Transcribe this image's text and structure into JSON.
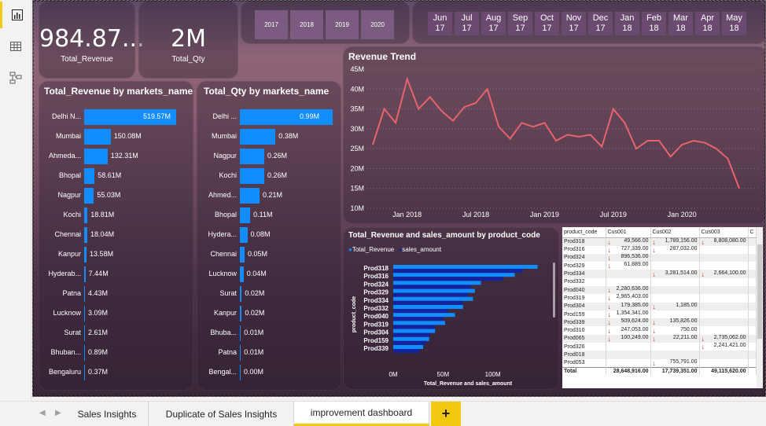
{
  "rail": {
    "icons": [
      "report-view-icon",
      "data-view-icon",
      "model-view-icon"
    ]
  },
  "kpi": {
    "revenue": {
      "value": "984.87...",
      "label": "Total_Revenue"
    },
    "qty": {
      "value": "2M",
      "label": "Total_Qty"
    }
  },
  "year_slicer": [
    "2017",
    "2018",
    "2019",
    "2020"
  ],
  "month_slicer": [
    {
      "m": "Jun",
      "y": "17"
    },
    {
      "m": "Jul",
      "y": "17"
    },
    {
      "m": "Aug",
      "y": "17"
    },
    {
      "m": "Sep",
      "y": "17"
    },
    {
      "m": "Oct",
      "y": "17"
    },
    {
      "m": "Nov",
      "y": "17"
    },
    {
      "m": "Dec",
      "y": "17"
    },
    {
      "m": "Jan",
      "y": "18"
    },
    {
      "m": "Feb",
      "y": "18"
    },
    {
      "m": "Mar",
      "y": "18"
    },
    {
      "m": "Apr",
      "y": "18"
    },
    {
      "m": "May",
      "y": "18"
    }
  ],
  "revenue_by_market": {
    "title": "Total_Revenue by markets_name",
    "bar_color": "#118dff",
    "items": [
      {
        "name": "Delhi N...",
        "value": 519.57,
        "label": "519.57M"
      },
      {
        "name": "Mumbai",
        "value": 150.08,
        "label": "150.08M"
      },
      {
        "name": "Ahmeda...",
        "value": 132.31,
        "label": "132.31M"
      },
      {
        "name": "Bhopal",
        "value": 58.61,
        "label": "58.61M"
      },
      {
        "name": "Nagpur",
        "value": 55.03,
        "label": "55.03M"
      },
      {
        "name": "Kochi",
        "value": 18.81,
        "label": "18.81M"
      },
      {
        "name": "Chennai",
        "value": 18.04,
        "label": "18.04M"
      },
      {
        "name": "Kanpur",
        "value": 13.58,
        "label": "13.58M"
      },
      {
        "name": "Hyderab...",
        "value": 7.44,
        "label": "7.44M"
      },
      {
        "name": "Patna",
        "value": 4.43,
        "label": "4.43M"
      },
      {
        "name": "Lucknow",
        "value": 3.09,
        "label": "3.09M"
      },
      {
        "name": "Surat",
        "value": 2.61,
        "label": "2.61M"
      },
      {
        "name": "Bhuban...",
        "value": 0.89,
        "label": "0.89M"
      },
      {
        "name": "Bengaluru",
        "value": 0.37,
        "label": "0.37M"
      }
    ]
  },
  "qty_by_market": {
    "title": "Total_Qty by markets_name",
    "bar_color": "#118dff",
    "items": [
      {
        "name": "Delhi ...",
        "value": 0.99,
        "label": "0.99M"
      },
      {
        "name": "Mumbai",
        "value": 0.38,
        "label": "0.38M"
      },
      {
        "name": "Nagpur",
        "value": 0.26,
        "label": "0.26M"
      },
      {
        "name": "Kochi",
        "value": 0.26,
        "label": "0.26M"
      },
      {
        "name": "Ahmed...",
        "value": 0.21,
        "label": "0.21M"
      },
      {
        "name": "Bhopal",
        "value": 0.11,
        "label": "0.11M"
      },
      {
        "name": "Hydera...",
        "value": 0.08,
        "label": "0.08M"
      },
      {
        "name": "Chennai",
        "value": 0.05,
        "label": "0.05M"
      },
      {
        "name": "Lucknow",
        "value": 0.04,
        "label": "0.04M"
      },
      {
        "name": "Surat",
        "value": 0.02,
        "label": "0.02M"
      },
      {
        "name": "Kanpur",
        "value": 0.02,
        "label": "0.02M"
      },
      {
        "name": "Bhuba...",
        "value": 0.01,
        "label": "0.01M"
      },
      {
        "name": "Patna",
        "value": 0.01,
        "label": "0.01M"
      },
      {
        "name": "Bengal...",
        "value": 0.0,
        "label": "0.00M"
      }
    ]
  },
  "revenue_trend": {
    "title": "Revenue Trend",
    "line_color": "#e8636f",
    "y_ticks": [
      "45M",
      "40M",
      "35M",
      "30M",
      "25M",
      "20M",
      "15M",
      "10M"
    ],
    "x_ticks": [
      "Jan 2018",
      "Jul 2018",
      "Jan 2019",
      "Jul 2019",
      "Jan 2020"
    ]
  },
  "product_chart": {
    "title": "Total_Revenue and sales_amount by product_code",
    "legend": [
      {
        "name": "Total_Revenue",
        "color": "#118dff"
      },
      {
        "name": "sales_amount",
        "color": "#12239e"
      }
    ],
    "y_axis_title": "product_code",
    "x_axis_title": "Total_Revenue and sales_amount",
    "x_ticks": [
      "0M",
      "50M",
      "100M"
    ]
  },
  "chart_data": [
    {
      "type": "bar",
      "title": "Total_Revenue by markets_name",
      "categories": [
        "Delhi N...",
        "Mumbai",
        "Ahmeda...",
        "Bhopal",
        "Nagpur",
        "Kochi",
        "Chennai",
        "Kanpur",
        "Hyderab...",
        "Patna",
        "Lucknow",
        "Surat",
        "Bhuban...",
        "Bengaluru"
      ],
      "values": [
        519.57,
        150.08,
        132.31,
        58.61,
        55.03,
        18.81,
        18.04,
        13.58,
        7.44,
        4.43,
        3.09,
        2.61,
        0.89,
        0.37
      ]
    },
    {
      "type": "bar",
      "title": "Total_Qty by markets_name",
      "categories": [
        "Delhi ...",
        "Mumbai",
        "Nagpur",
        "Kochi",
        "Ahmed...",
        "Bhopal",
        "Hydera...",
        "Chennai",
        "Lucknow",
        "Surat",
        "Kanpur",
        "Bhuba...",
        "Patna",
        "Bengal..."
      ],
      "values": [
        0.99,
        0.38,
        0.26,
        0.26,
        0.21,
        0.11,
        0.08,
        0.05,
        0.04,
        0.02,
        0.02,
        0.01,
        0.01,
        0.0
      ]
    },
    {
      "type": "line",
      "title": "Revenue Trend",
      "x": [
        "2017-10",
        "2017-11",
        "2017-12",
        "2018-01",
        "2018-02",
        "2018-03",
        "2018-04",
        "2018-05",
        "2018-06",
        "2018-07",
        "2018-08",
        "2018-09",
        "2018-10",
        "2018-11",
        "2018-12",
        "2019-01",
        "2019-02",
        "2019-03",
        "2019-04",
        "2019-05",
        "2019-06",
        "2019-07",
        "2019-08",
        "2019-09",
        "2019-10",
        "2019-11",
        "2019-12",
        "2020-01",
        "2020-02",
        "2020-03",
        "2020-04",
        "2020-05",
        "2020-06"
      ],
      "series": [
        {
          "values": [
            26,
            35,
            31.5,
            42.5,
            35,
            38,
            34.5,
            32,
            35.5,
            36.5,
            40,
            30.5,
            27.5,
            31.5,
            30.5,
            31.5,
            27,
            28.5,
            28,
            28.5,
            25.5,
            35,
            31.5,
            25,
            27,
            27,
            23,
            26,
            27,
            26.5,
            25,
            22.5,
            15
          ]
        }
      ],
      "ylim": [
        10,
        45
      ]
    },
    {
      "type": "bar",
      "title": "Total_Revenue and sales_amount by product_code",
      "categories": [
        "Prod318",
        "Prod316",
        "Prod324",
        "Prod329",
        "Prod334",
        "Prod332",
        "Prod040",
        "Prod319",
        "Prod304",
        "Prod159",
        "Prod339"
      ],
      "series": [
        {
          "name": "Total_Revenue",
          "values": [
            145,
            122,
            88,
            82,
            80,
            70,
            62,
            52,
            42,
            36,
            30
          ]
        },
        {
          "name": "sales_amount",
          "values": [
            130,
            110,
            78,
            75,
            70,
            55,
            50,
            42,
            37,
            33,
            26
          ]
        }
      ],
      "xlim": [
        0,
        150
      ],
      "xlabel": "Total_Revenue and sales_amount",
      "ylabel": "product_code"
    }
  ],
  "matrix": {
    "headers": [
      "product_code",
      "Cus001",
      "Cus002",
      "Cus003",
      "C"
    ],
    "rows": [
      [
        "Prod318",
        "49,566.00",
        "1,789,156.00",
        "8,808,080.00"
      ],
      [
        "Prod316",
        "727,339.00",
        "287,032.00",
        ""
      ],
      [
        "Prod324",
        "896,536.00",
        "",
        ""
      ],
      [
        "Prod329",
        "61,889.00",
        "",
        ""
      ],
      [
        "Prod334",
        "",
        "3,281,514.00",
        "2,664,100.00"
      ],
      [
        "Prod332",
        "",
        "",
        ""
      ],
      [
        "Prod040",
        "2,280,636.00",
        "",
        ""
      ],
      [
        "Prod319",
        "2,965,403.00",
        "",
        ""
      ],
      [
        "Prod304",
        "179,385.00",
        "1,185.00",
        ""
      ],
      [
        "Prod159",
        "1,354,341.00",
        "",
        ""
      ],
      [
        "Prod339",
        "509,624.00",
        "135,826.00",
        ""
      ],
      [
        "Prod310",
        "247,053.00",
        "750.00",
        ""
      ],
      [
        "Prod065",
        "100,249.00",
        "22,211.00",
        "2,735,062.00"
      ],
      [
        "Prod326",
        "",
        "",
        "2,241,421.00"
      ],
      [
        "Prod018",
        "",
        "",
        ""
      ],
      [
        "Prod053",
        "",
        "755,791.00",
        ""
      ]
    ],
    "arrows": [
      [
        true,
        true,
        true
      ],
      [
        true,
        true,
        false
      ],
      [
        true,
        false,
        false
      ],
      [
        true,
        false,
        false
      ],
      [
        false,
        true,
        true
      ],
      [
        false,
        false,
        false
      ],
      [
        true,
        false,
        false
      ],
      [
        true,
        false,
        false
      ],
      [
        true,
        true,
        false
      ],
      [
        true,
        false,
        false
      ],
      [
        true,
        true,
        false
      ],
      [
        true,
        true,
        false
      ],
      [
        true,
        true,
        true
      ],
      [
        false,
        false,
        true
      ],
      [
        false,
        false,
        false
      ],
      [
        false,
        true,
        false
      ]
    ],
    "total": [
      "Total",
      "28,648,916.00",
      "17,739,351.00",
      "49,115,620.00"
    ]
  },
  "tabs": [
    {
      "label": "Sales Insights"
    },
    {
      "label": "Duplicate of Sales Insights"
    },
    {
      "label": "improvement dashboard"
    }
  ],
  "add_tab_label": "+"
}
